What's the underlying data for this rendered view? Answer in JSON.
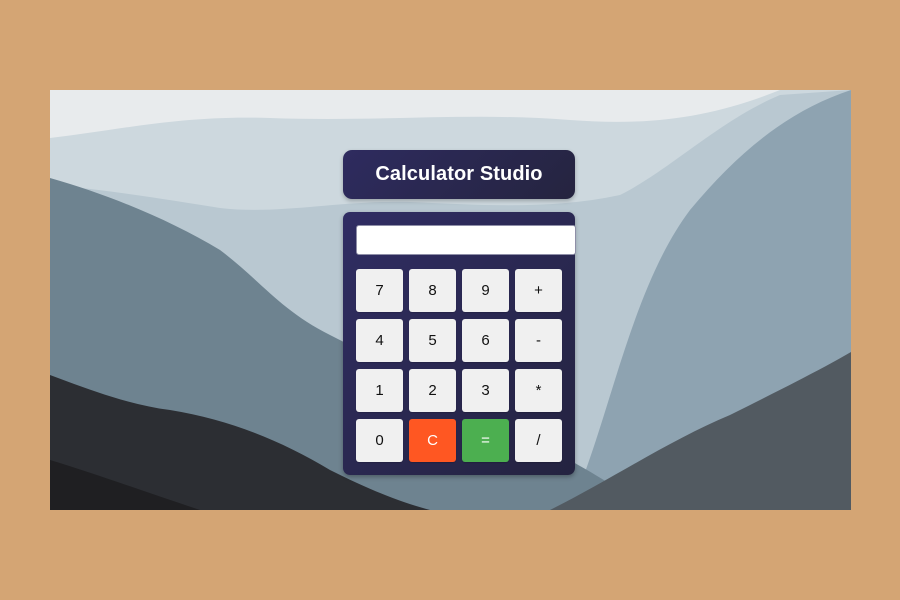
{
  "app": {
    "title": "Calculator Studio"
  },
  "display": {
    "value": ""
  },
  "keypad": {
    "rows": [
      [
        "7",
        "8",
        "9",
        "+"
      ],
      [
        "4",
        "5",
        "6",
        "-"
      ],
      [
        "1",
        "2",
        "3",
        "*"
      ],
      [
        "0",
        "C",
        "=",
        "/"
      ]
    ]
  },
  "colors": {
    "page_background": "#d4a574",
    "panel": "#2e2b5f",
    "key": "#f0f0f0",
    "clear_key": "#ff5722",
    "equals_key": "#4caf50"
  }
}
